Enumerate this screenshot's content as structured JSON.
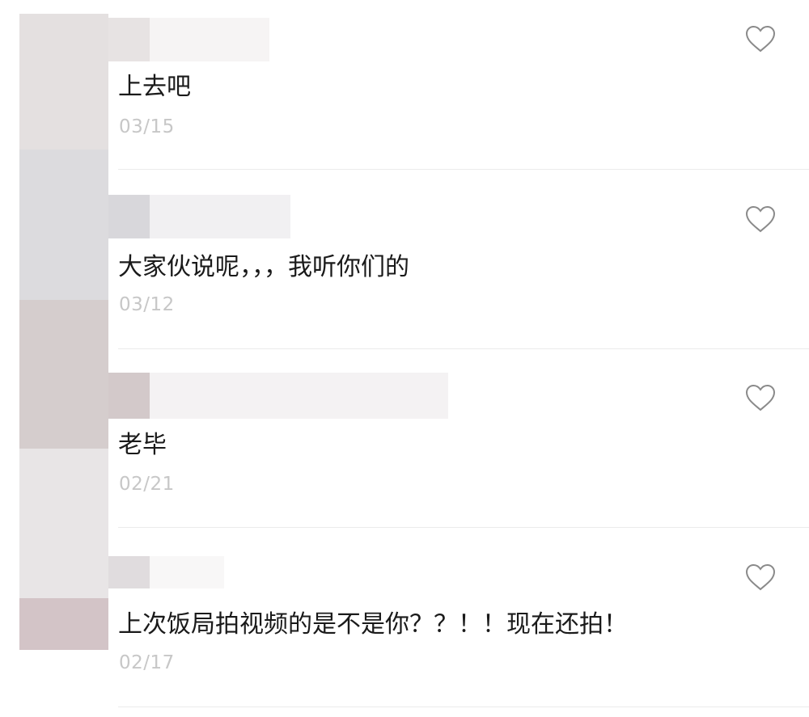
{
  "comments": [
    {
      "text": "上去吧",
      "date": "03/15",
      "liked": false
    },
    {
      "text": "大家伙说呢，，，我听你们的",
      "date": "03/12",
      "liked": false
    },
    {
      "text": "老毕",
      "date": "02/21",
      "liked": false
    },
    {
      "text": "上次饭局拍视频的是不是你？？！！现在还拍！",
      "date": "02/17",
      "liked": false
    }
  ],
  "icons": {
    "like": "heart-outline-icon"
  },
  "colors": {
    "text": "#1a1a1a",
    "date": "#c7c7c7",
    "divider": "#ebebeb",
    "heart_stroke": "#8a8a8a"
  }
}
